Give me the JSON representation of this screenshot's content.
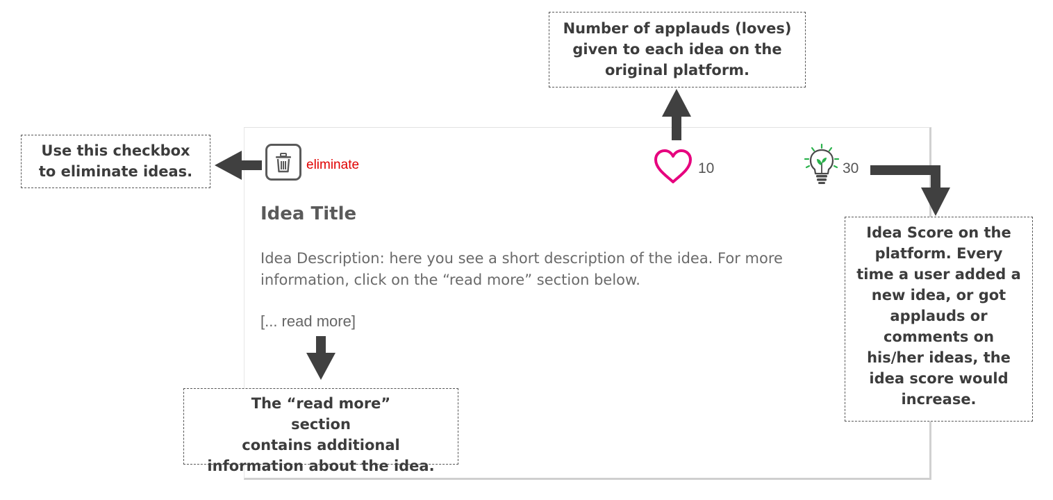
{
  "idea_card": {
    "eliminate_label": "eliminate",
    "applauds_count": "10",
    "score": "30",
    "title": "Idea Title",
    "description": "Idea Description: here you see a short description of the idea. For more information, click on the “read more” section below.",
    "read_more_label": "[... read more]",
    "colors": {
      "eliminate": "#e00000",
      "heart": "#e6007e",
      "bulb_rays": "#2bb24c"
    },
    "icons": [
      "trash-icon",
      "heart-icon",
      "lightbulb-icon"
    ]
  },
  "annotations": {
    "eliminate_note": "Use this checkbox\nto eliminate ideas.",
    "applauds_note": "Number of applauds (loves)\ngiven to each idea on the\noriginal platform.",
    "score_note": "Idea Score on the\nplatform. Every\ntime a user added a\nnew idea, or got\napplauds or\ncomments on\nhis/her ideas, the\nidea score would\nincrease.",
    "read_more_note": "The “read more”\nsection\ncontains additional\ninformation about the idea."
  }
}
